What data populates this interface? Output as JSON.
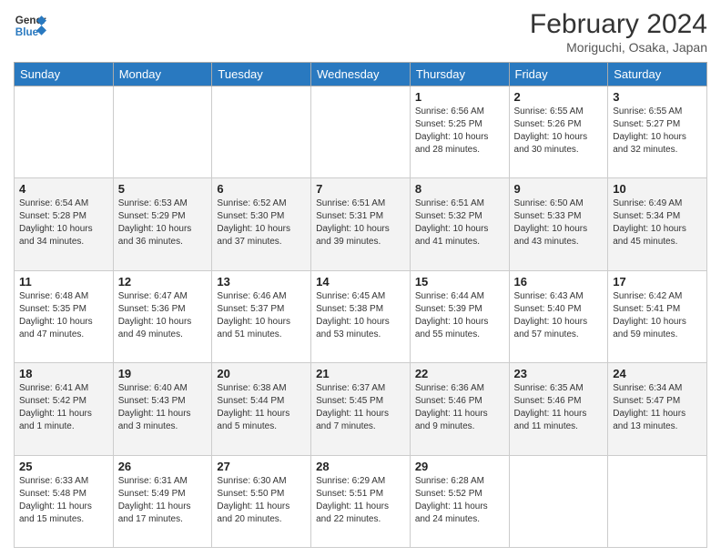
{
  "logo": {
    "line1": "General",
    "line2": "Blue"
  },
  "title": {
    "month_year": "February 2024",
    "location": "Moriguchi, Osaka, Japan"
  },
  "weekdays": [
    "Sunday",
    "Monday",
    "Tuesday",
    "Wednesday",
    "Thursday",
    "Friday",
    "Saturday"
  ],
  "weeks": [
    [
      {
        "day": "",
        "info": ""
      },
      {
        "day": "",
        "info": ""
      },
      {
        "day": "",
        "info": ""
      },
      {
        "day": "",
        "info": ""
      },
      {
        "day": "1",
        "info": "Sunrise: 6:56 AM\nSunset: 5:25 PM\nDaylight: 10 hours\nand 28 minutes."
      },
      {
        "day": "2",
        "info": "Sunrise: 6:55 AM\nSunset: 5:26 PM\nDaylight: 10 hours\nand 30 minutes."
      },
      {
        "day": "3",
        "info": "Sunrise: 6:55 AM\nSunset: 5:27 PM\nDaylight: 10 hours\nand 32 minutes."
      }
    ],
    [
      {
        "day": "4",
        "info": "Sunrise: 6:54 AM\nSunset: 5:28 PM\nDaylight: 10 hours\nand 34 minutes."
      },
      {
        "day": "5",
        "info": "Sunrise: 6:53 AM\nSunset: 5:29 PM\nDaylight: 10 hours\nand 36 minutes."
      },
      {
        "day": "6",
        "info": "Sunrise: 6:52 AM\nSunset: 5:30 PM\nDaylight: 10 hours\nand 37 minutes."
      },
      {
        "day": "7",
        "info": "Sunrise: 6:51 AM\nSunset: 5:31 PM\nDaylight: 10 hours\nand 39 minutes."
      },
      {
        "day": "8",
        "info": "Sunrise: 6:51 AM\nSunset: 5:32 PM\nDaylight: 10 hours\nand 41 minutes."
      },
      {
        "day": "9",
        "info": "Sunrise: 6:50 AM\nSunset: 5:33 PM\nDaylight: 10 hours\nand 43 minutes."
      },
      {
        "day": "10",
        "info": "Sunrise: 6:49 AM\nSunset: 5:34 PM\nDaylight: 10 hours\nand 45 minutes."
      }
    ],
    [
      {
        "day": "11",
        "info": "Sunrise: 6:48 AM\nSunset: 5:35 PM\nDaylight: 10 hours\nand 47 minutes."
      },
      {
        "day": "12",
        "info": "Sunrise: 6:47 AM\nSunset: 5:36 PM\nDaylight: 10 hours\nand 49 minutes."
      },
      {
        "day": "13",
        "info": "Sunrise: 6:46 AM\nSunset: 5:37 PM\nDaylight: 10 hours\nand 51 minutes."
      },
      {
        "day": "14",
        "info": "Sunrise: 6:45 AM\nSunset: 5:38 PM\nDaylight: 10 hours\nand 53 minutes."
      },
      {
        "day": "15",
        "info": "Sunrise: 6:44 AM\nSunset: 5:39 PM\nDaylight: 10 hours\nand 55 minutes."
      },
      {
        "day": "16",
        "info": "Sunrise: 6:43 AM\nSunset: 5:40 PM\nDaylight: 10 hours\nand 57 minutes."
      },
      {
        "day": "17",
        "info": "Sunrise: 6:42 AM\nSunset: 5:41 PM\nDaylight: 10 hours\nand 59 minutes."
      }
    ],
    [
      {
        "day": "18",
        "info": "Sunrise: 6:41 AM\nSunset: 5:42 PM\nDaylight: 11 hours\nand 1 minute."
      },
      {
        "day": "19",
        "info": "Sunrise: 6:40 AM\nSunset: 5:43 PM\nDaylight: 11 hours\nand 3 minutes."
      },
      {
        "day": "20",
        "info": "Sunrise: 6:38 AM\nSunset: 5:44 PM\nDaylight: 11 hours\nand 5 minutes."
      },
      {
        "day": "21",
        "info": "Sunrise: 6:37 AM\nSunset: 5:45 PM\nDaylight: 11 hours\nand 7 minutes."
      },
      {
        "day": "22",
        "info": "Sunrise: 6:36 AM\nSunset: 5:46 PM\nDaylight: 11 hours\nand 9 minutes."
      },
      {
        "day": "23",
        "info": "Sunrise: 6:35 AM\nSunset: 5:46 PM\nDaylight: 11 hours\nand 11 minutes."
      },
      {
        "day": "24",
        "info": "Sunrise: 6:34 AM\nSunset: 5:47 PM\nDaylight: 11 hours\nand 13 minutes."
      }
    ],
    [
      {
        "day": "25",
        "info": "Sunrise: 6:33 AM\nSunset: 5:48 PM\nDaylight: 11 hours\nand 15 minutes."
      },
      {
        "day": "26",
        "info": "Sunrise: 6:31 AM\nSunset: 5:49 PM\nDaylight: 11 hours\nand 17 minutes."
      },
      {
        "day": "27",
        "info": "Sunrise: 6:30 AM\nSunset: 5:50 PM\nDaylight: 11 hours\nand 20 minutes."
      },
      {
        "day": "28",
        "info": "Sunrise: 6:29 AM\nSunset: 5:51 PM\nDaylight: 11 hours\nand 22 minutes."
      },
      {
        "day": "29",
        "info": "Sunrise: 6:28 AM\nSunset: 5:52 PM\nDaylight: 11 hours\nand 24 minutes."
      },
      {
        "day": "",
        "info": ""
      },
      {
        "day": "",
        "info": ""
      }
    ]
  ]
}
